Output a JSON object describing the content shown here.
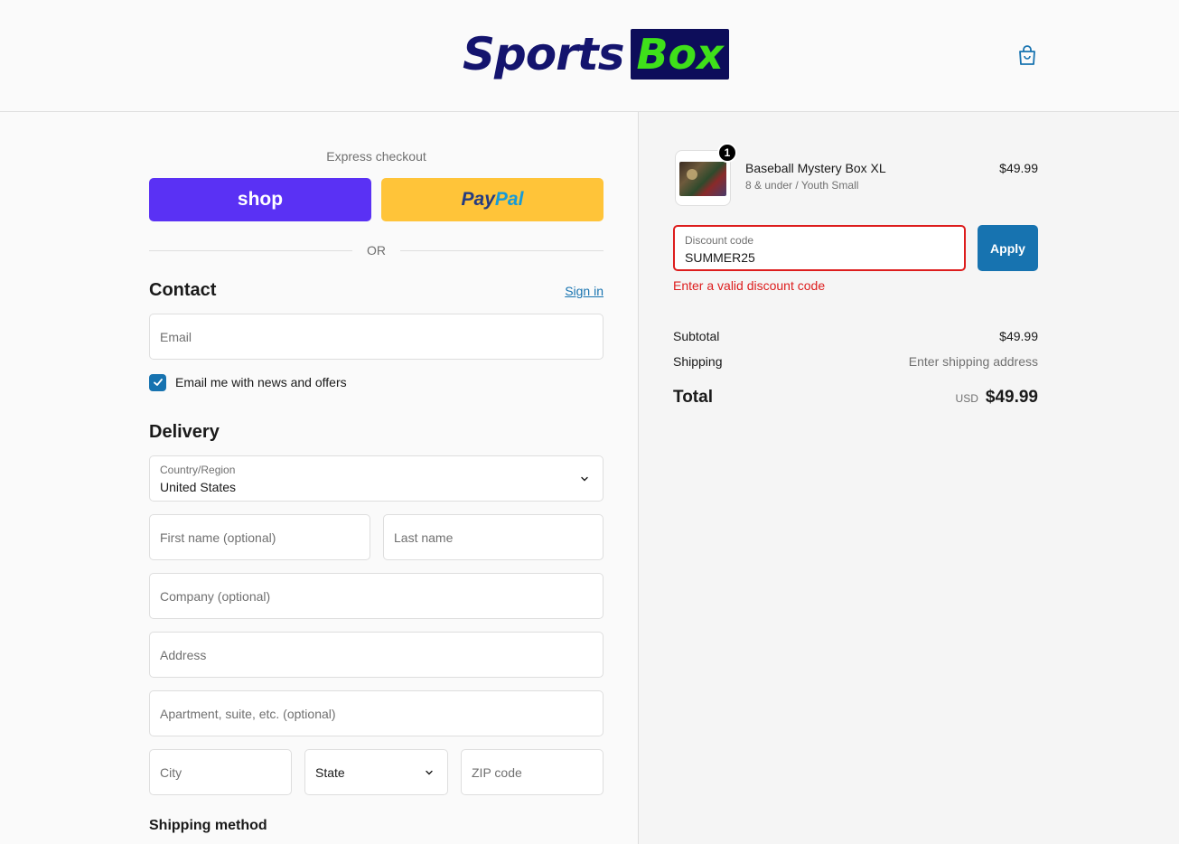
{
  "header": {
    "logo_part1": "Sports",
    "logo_part2": "Box",
    "cart_icon": "shopping-bag-icon"
  },
  "express": {
    "title": "Express checkout",
    "shop_label": "shop",
    "paypal_part1": "Pay",
    "paypal_part2": "Pal",
    "or_label": "OR"
  },
  "contact": {
    "title": "Contact",
    "signin_label": "Sign in",
    "email_placeholder": "Email",
    "newsletter_label": "Email me with news and offers",
    "newsletter_checked": true
  },
  "delivery": {
    "title": "Delivery",
    "country_label": "Country/Region",
    "country_value": "United States",
    "first_name_placeholder": "First name (optional)",
    "last_name_placeholder": "Last name",
    "company_placeholder": "Company (optional)",
    "address_placeholder": "Address",
    "apartment_placeholder": "Apartment, suite, etc. (optional)",
    "city_placeholder": "City",
    "state_placeholder": "State",
    "zip_placeholder": "ZIP code"
  },
  "shipping_method": {
    "title": "Shipping method"
  },
  "order": {
    "product_name": "Baseball Mystery Box XL",
    "product_variant": "8 & under / Youth Small",
    "product_price": "$49.99",
    "quantity": "1",
    "discount_label": "Discount code",
    "discount_value": "SUMMER25",
    "apply_label": "Apply",
    "error_text": "Enter a valid discount code",
    "subtotal_label": "Subtotal",
    "subtotal_value": "$49.99",
    "shipping_label": "Shipping",
    "shipping_value": "Enter shipping address",
    "total_label": "Total",
    "currency": "USD",
    "total_value": "$49.99"
  },
  "colors": {
    "shop_pay": "#5a31f4",
    "paypal": "#ffc439",
    "accent": "#1773b0",
    "error": "#dd1d1d",
    "logo_navy": "#14146e",
    "logo_green": "#3fe01a"
  }
}
